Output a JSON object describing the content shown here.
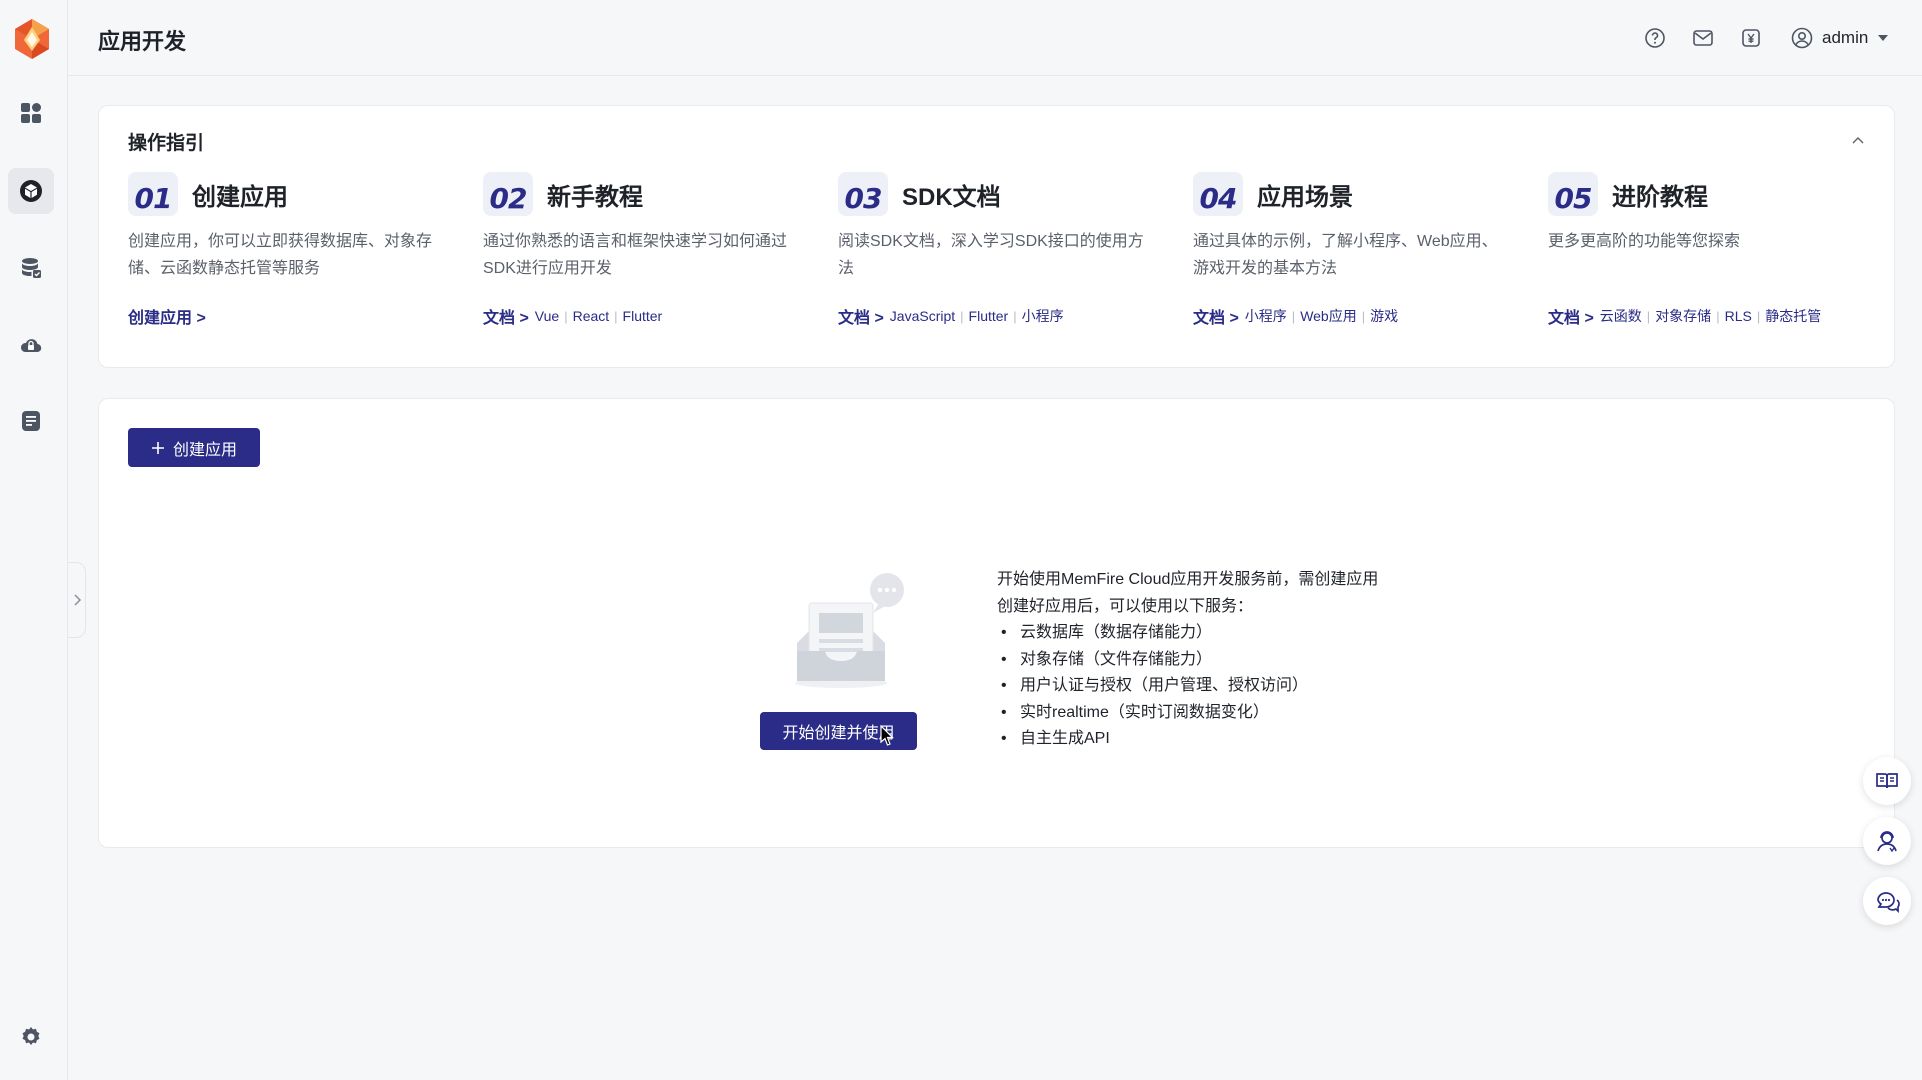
{
  "header": {
    "title": "应用开发",
    "username": "admin"
  },
  "guide": {
    "title": "操作指引",
    "steps": [
      {
        "num": "01",
        "title": "创建应用",
        "desc": "创建应用，你可以立即获得数据库、对象存储、云函数静态托管等服务",
        "lead": "创建应用 >",
        "links": []
      },
      {
        "num": "02",
        "title": "新手教程",
        "desc": "通过你熟悉的语言和框架快速学习如何通过SDK进行应用开发",
        "lead": "文档 >",
        "links": [
          "Vue",
          "React",
          "Flutter"
        ]
      },
      {
        "num": "03",
        "title": "SDK文档",
        "desc": "阅读SDK文档，深入学习SDK接口的使用方法",
        "lead": "文档 >",
        "links": [
          "JavaScript",
          "Flutter",
          "小程序"
        ]
      },
      {
        "num": "04",
        "title": "应用场景",
        "desc": "通过具体的示例，了解小程序、Web应用、游戏开发的基本方法",
        "lead": "文档 >",
        "links": [
          "小程序",
          "Web应用",
          "游戏"
        ]
      },
      {
        "num": "05",
        "title": "进阶教程",
        "desc": "更多更高阶的功能等您探索",
        "lead": "文档 >",
        "links": [
          "云函数",
          "对象存储",
          "RLS",
          "静态托管"
        ]
      }
    ]
  },
  "main": {
    "create_label": "创建应用",
    "start_label": "开始创建并使用",
    "info_line1": "开始使用MemFire Cloud应用开发服务前，需创建应用",
    "info_line2": "创建好应用后，可以使用以下服务：",
    "services": [
      "云数据库（数据存储能力）",
      "对象存储（文件存储能力）",
      "用户认证与授权（用户管理、授权访问）",
      "实时realtime（实时订阅数据变化）",
      "自主生成API"
    ]
  },
  "colors": {
    "primary": "#2a2c87",
    "background": "#f6f7f9",
    "card": "#ffffff"
  },
  "icons": {
    "logo": "memfire-logo",
    "sidebar": [
      "dashboard-icon",
      "app-cube-icon",
      "database-icon",
      "cloud-lock-icon",
      "document-icon",
      "settings-gear-icon"
    ],
    "header": [
      "help-icon",
      "mail-icon",
      "billing-icon",
      "user-icon",
      "caret-down-icon"
    ],
    "float": [
      "docs-book-icon",
      "support-agent-icon",
      "chat-icon"
    ]
  }
}
